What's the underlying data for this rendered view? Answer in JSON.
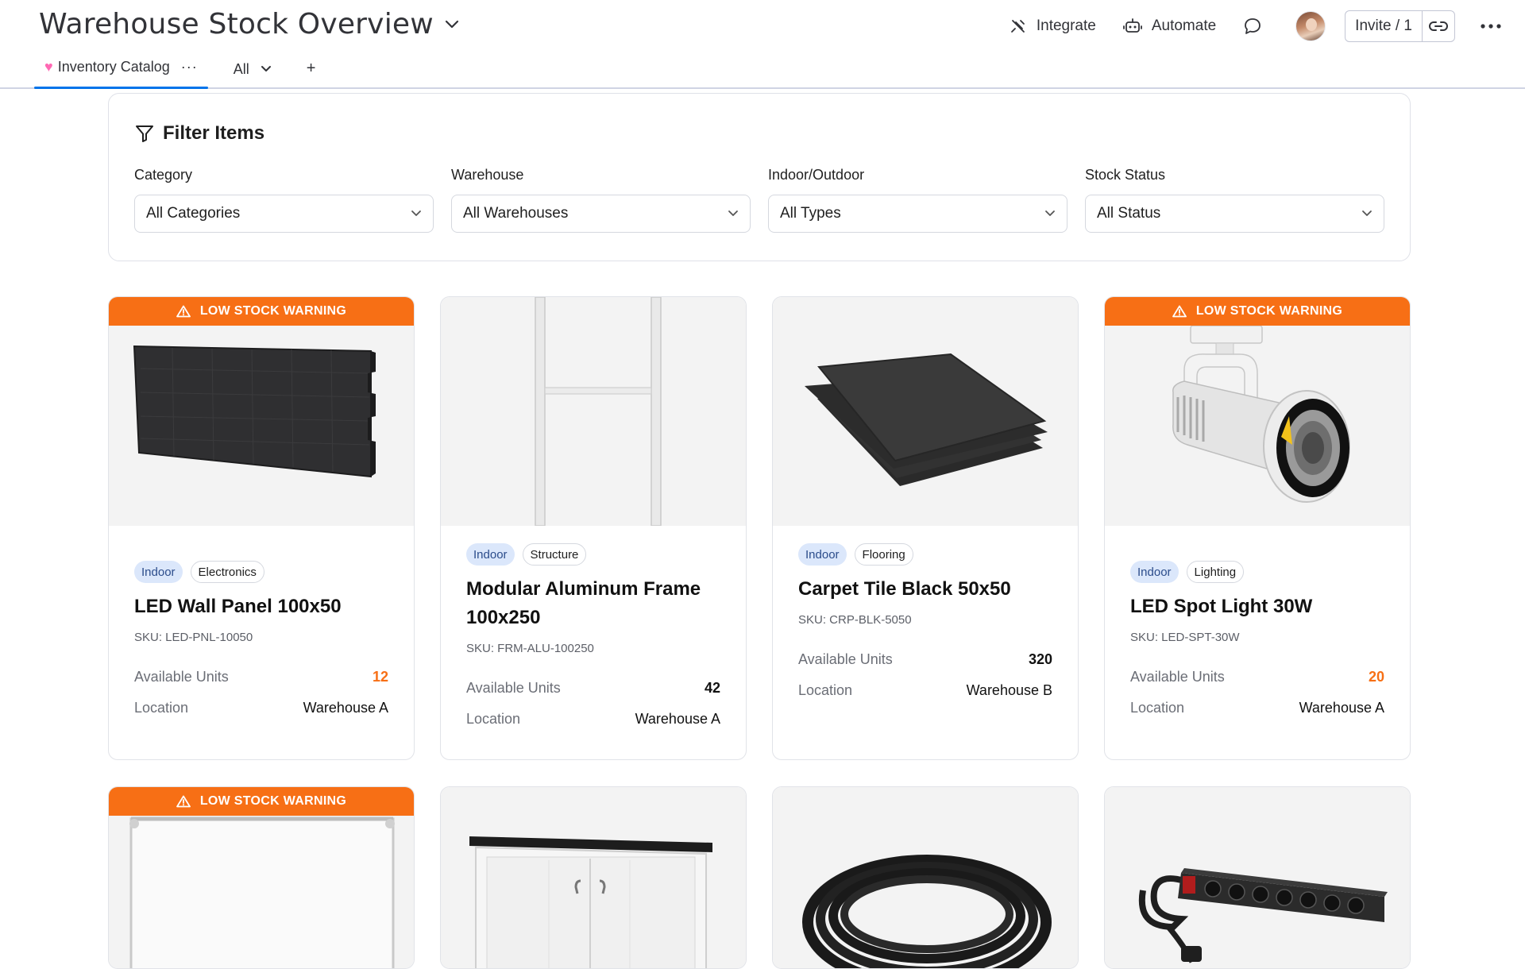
{
  "header": {
    "title": "Warehouse Stock Overview",
    "actions": {
      "integrate": "Integrate",
      "automate": "Automate",
      "invite": "Invite / 1"
    },
    "tabs": {
      "active": "Inventory Catalog",
      "view": "All",
      "add": "+"
    }
  },
  "filters": {
    "heading": "Filter Items",
    "groups": [
      {
        "label": "Category",
        "value": "All Categories"
      },
      {
        "label": "Warehouse",
        "value": "All Warehouses"
      },
      {
        "label": "Indoor/Outdoor",
        "value": "All Types"
      },
      {
        "label": "Stock Status",
        "value": "All Status"
      }
    ]
  },
  "warning_text": "LOW STOCK WARNING",
  "units_label": "Available Units",
  "location_label": "Location",
  "colors": {
    "accent": "#0073ea",
    "warning": "#f76f15",
    "tag_blue": "#dbe7fb"
  },
  "items": [
    {
      "name": "LED Wall Panel 100x50",
      "sku": "SKU: LED-PNL-10050",
      "location_tag": "Indoor",
      "category": "Electronics",
      "units": "12",
      "location": "Warehouse A",
      "low_stock": true,
      "image_icon": "led-panel-image"
    },
    {
      "name": "Modular Aluminum Frame 100x250",
      "sku": "SKU: FRM-ALU-100250",
      "location_tag": "Indoor",
      "category": "Structure",
      "units": "42",
      "location": "Warehouse A",
      "low_stock": false,
      "image_icon": "aluminum-frame-image"
    },
    {
      "name": "Carpet Tile Black 50x50",
      "sku": "SKU: CRP-BLK-5050",
      "location_tag": "Indoor",
      "category": "Flooring",
      "units": "320",
      "location": "Warehouse B",
      "low_stock": false,
      "image_icon": "carpet-tile-image"
    },
    {
      "name": "LED Spot Light 30W",
      "sku": "SKU: LED-SPT-30W",
      "location_tag": "Indoor",
      "category": "Lighting",
      "units": "20",
      "location": "Warehouse A",
      "low_stock": true,
      "image_icon": "spot-light-image"
    },
    {
      "low_stock": true,
      "image_icon": "banner-frame-image"
    },
    {
      "low_stock": false,
      "image_icon": "counter-cabinet-image"
    },
    {
      "low_stock": false,
      "image_icon": "cable-reel-image"
    },
    {
      "low_stock": false,
      "image_icon": "power-strip-image"
    }
  ]
}
